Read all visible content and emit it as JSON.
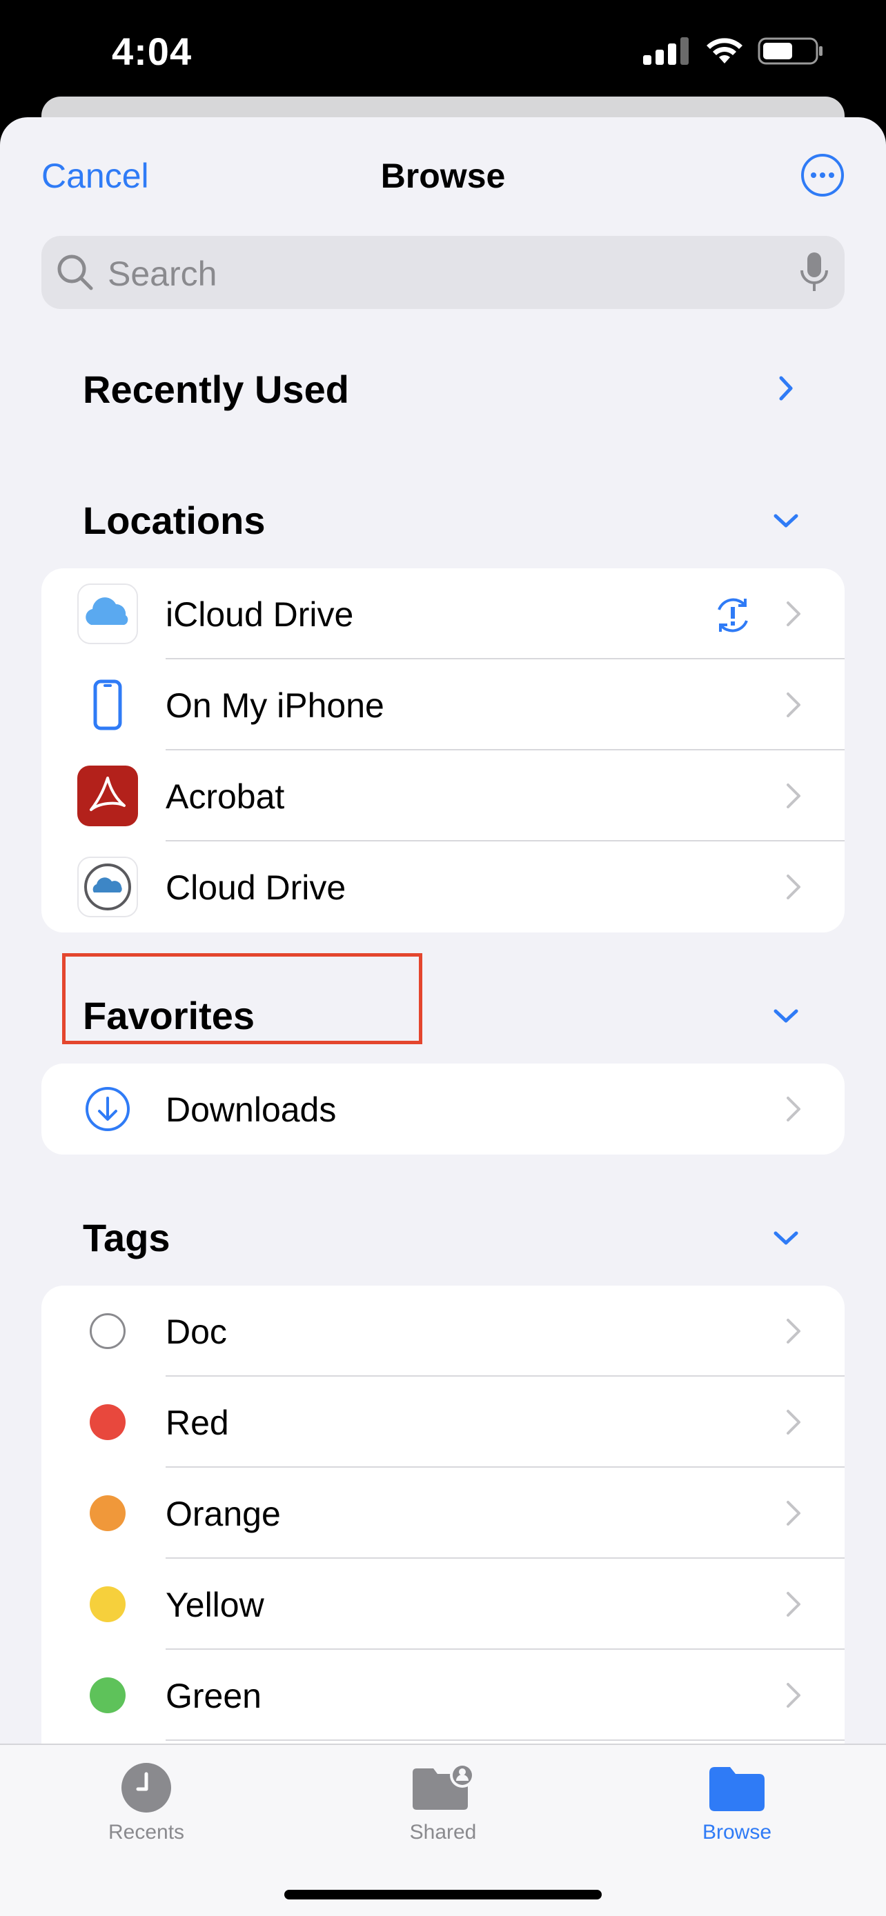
{
  "status_bar": {
    "time": "4:04"
  },
  "nav": {
    "cancel_label": "Cancel",
    "title": "Browse"
  },
  "search": {
    "placeholder": "Search"
  },
  "sections": {
    "recently_used": "Recently Used",
    "locations": "Locations",
    "favorites": "Favorites",
    "tags": "Tags"
  },
  "locations": [
    {
      "label": "iCloud Drive",
      "icon": "icloud-icon"
    },
    {
      "label": "On My iPhone",
      "icon": "iphone-icon"
    },
    {
      "label": "Acrobat",
      "icon": "acrobat-icon"
    },
    {
      "label": "Cloud Drive",
      "icon": "cloud-drive-icon"
    }
  ],
  "favorites": [
    {
      "label": "Downloads",
      "icon": "download-icon"
    }
  ],
  "tags": [
    {
      "label": "Doc",
      "color": "#ffffff"
    },
    {
      "label": "Red",
      "color": "#e8483d"
    },
    {
      "label": "Orange",
      "color": "#f0983a"
    },
    {
      "label": "Yellow",
      "color": "#f6d03c"
    },
    {
      "label": "Green",
      "color": "#5ec25a"
    }
  ],
  "tab_bar": {
    "recents": "Recents",
    "shared": "Shared",
    "browse": "Browse"
  },
  "colors": {
    "accent": "#2f7bf6",
    "highlight": "#e4462e"
  }
}
